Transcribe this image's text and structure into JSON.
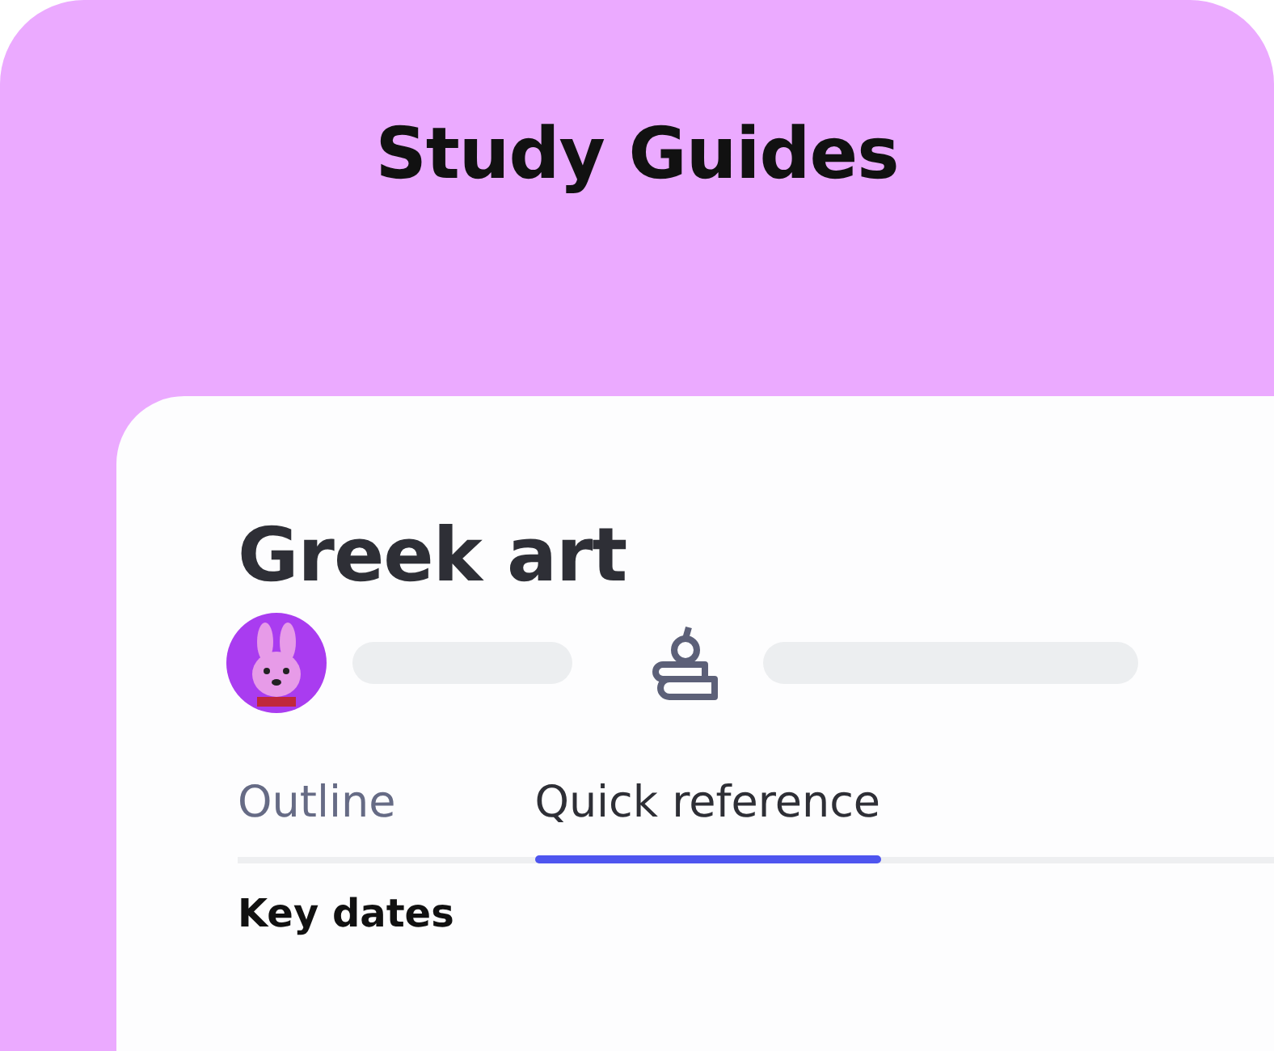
{
  "header": {
    "title": "Study Guides"
  },
  "guide": {
    "title": "Greek art"
  },
  "tabs": [
    {
      "label": "Outline",
      "selected": false
    },
    {
      "label": "Quick reference",
      "selected": true
    }
  ],
  "section": {
    "heading": "Key dates"
  }
}
